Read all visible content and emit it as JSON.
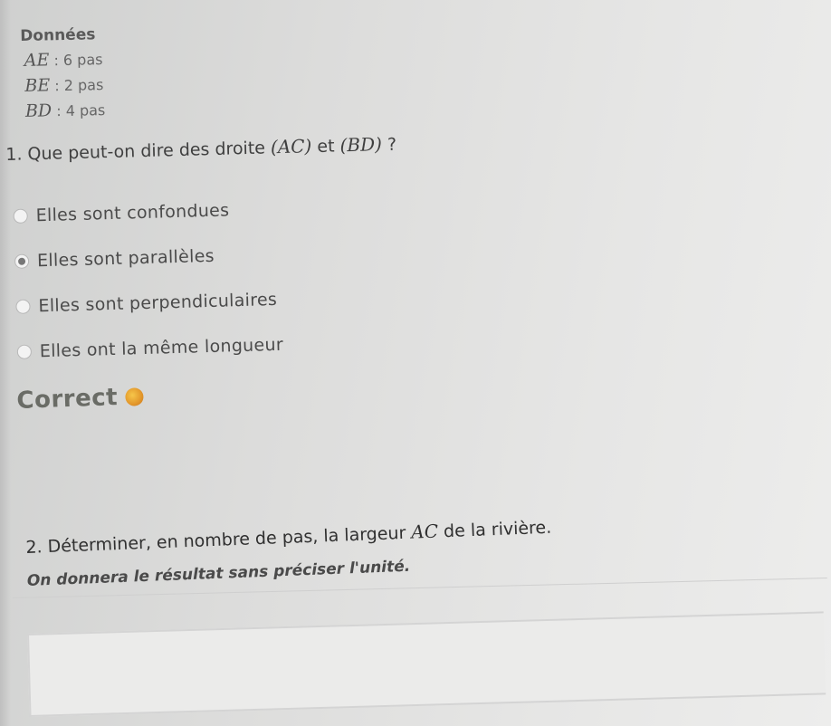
{
  "donnees": {
    "title": "Données",
    "lines": [
      {
        "label": "AE",
        "value": " : 6 pas"
      },
      {
        "label": "BE",
        "value": " : 2 pas"
      },
      {
        "label": "BD",
        "value": " : 4 pas"
      }
    ]
  },
  "question1": {
    "prefix": "1. Que peut-on dire des droite ",
    "line1": "(AC)",
    "middle": " et ",
    "line2": "(BD)",
    "suffix": " ?"
  },
  "options": [
    {
      "label": "Elles sont confondues",
      "selected": false
    },
    {
      "label": "Elles sont parallèles",
      "selected": true
    },
    {
      "label": "Elles sont perpendiculaires",
      "selected": false
    },
    {
      "label": "Elles ont la même longueur",
      "selected": false
    }
  ],
  "feedback": {
    "text": "Correct",
    "coin_icon": "coin-icon",
    "coin_glyph": "",
    "color": "#e2962a"
  },
  "question2": {
    "prefix": "2. Déterminer, en nombre de pas, la largeur ",
    "segment": "AC",
    "suffix": " de la rivière.",
    "hint": "On donnera le résultat sans préciser l'unité."
  },
  "answer": {
    "value": "",
    "placeholder": ""
  }
}
